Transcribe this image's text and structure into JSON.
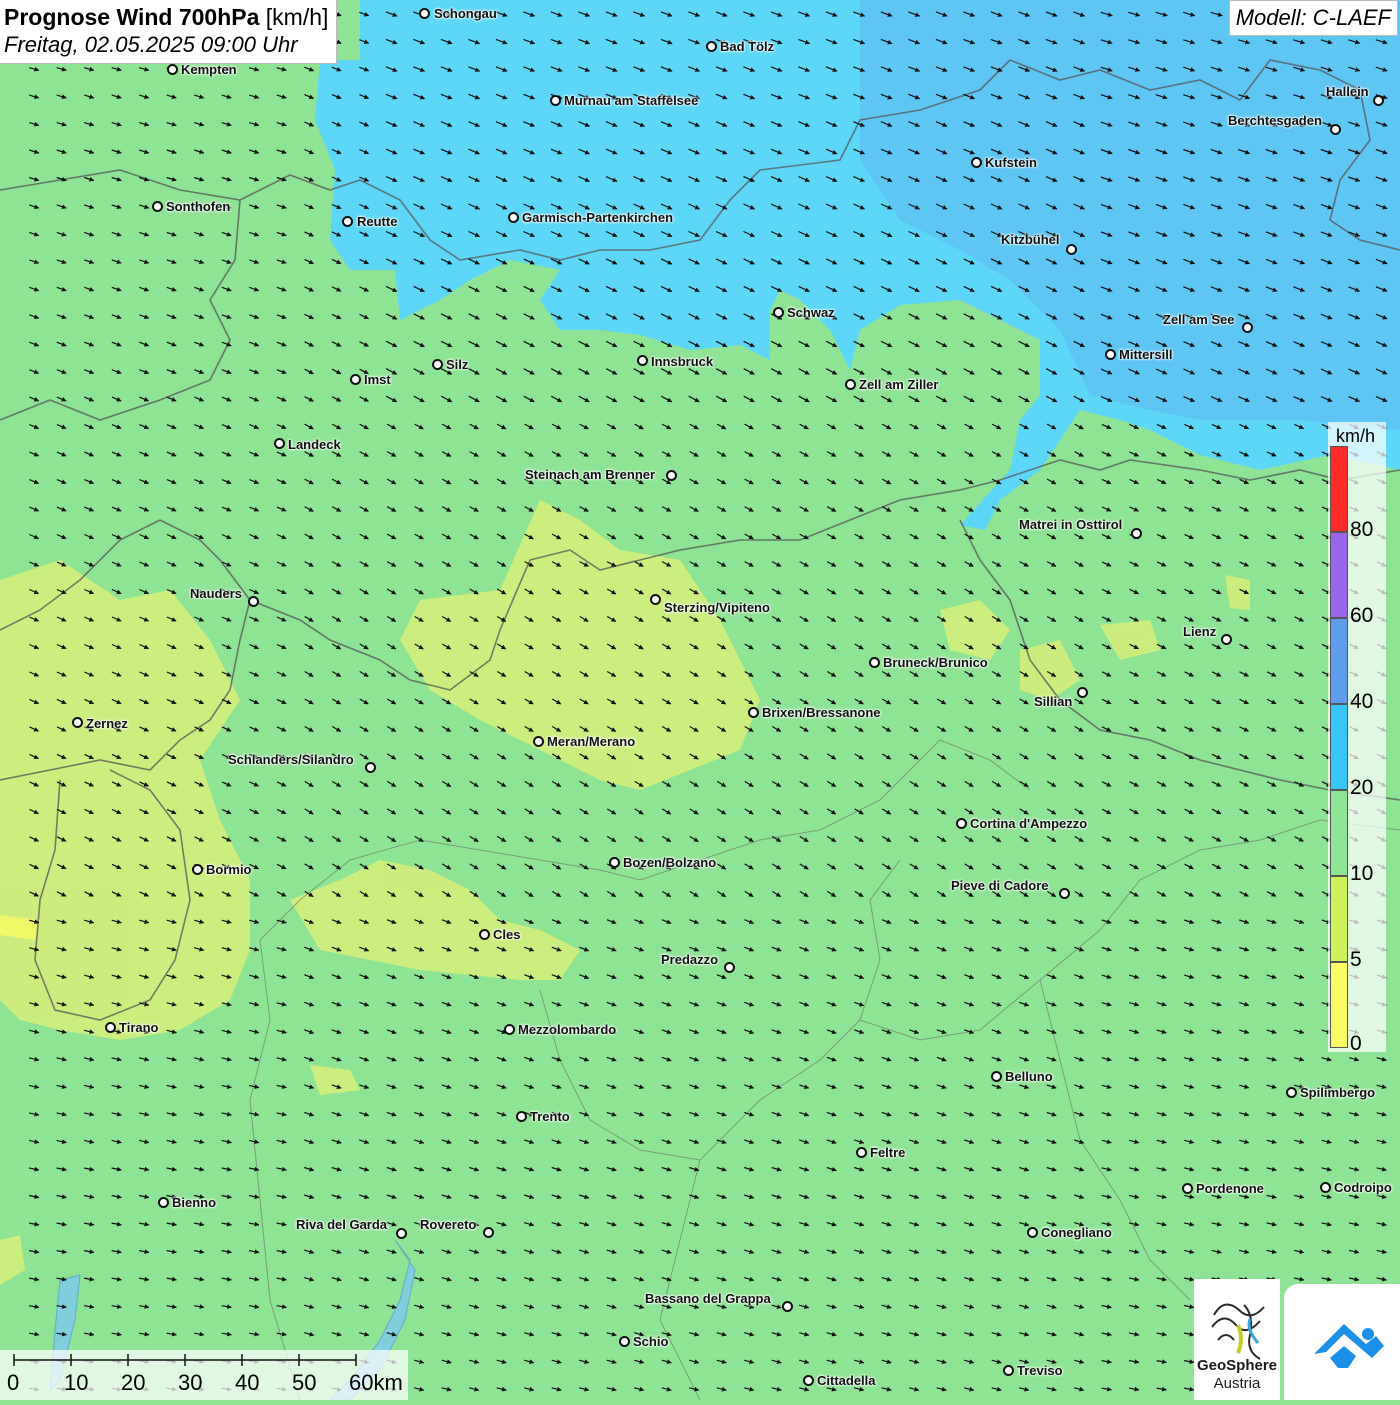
{
  "header": {
    "title_bold": "Prognose Wind 700hPa",
    "title_unit": "[km/h]",
    "subtitle": "Freitag, 02.05.2025 09:00 Uhr",
    "model": "Modell: C-LAEF"
  },
  "legend": {
    "unit": "km/h",
    "ticks": [
      "80",
      "60",
      "40",
      "20",
      "10",
      "5",
      "0"
    ],
    "colors": [
      "#fe2b2b",
      "#9a66ee",
      "#5f9ded",
      "#38c6f4",
      "#8fe394",
      "#cdf25a",
      "#fbfb66"
    ]
  },
  "scale_bar": {
    "labels": [
      "0",
      "10",
      "20",
      "30",
      "40",
      "50",
      "60km"
    ]
  },
  "logos": {
    "geosphere_line1": "GeoSphere",
    "geosphere_line2": "Austria"
  },
  "colors": {
    "calm_yellow": "#d3ee7c",
    "light_green": "#8fe394",
    "cyan": "#5dd7f8",
    "blue": "#5cb8ef"
  },
  "cities": [
    {
      "name": "Schongau",
      "dot": [
        424,
        13
      ],
      "lbl": [
        434,
        6
      ]
    },
    {
      "name": "Bad Tölz",
      "dot": [
        711,
        46
      ],
      "lbl": [
        720,
        39
      ]
    },
    {
      "name": "Kempten",
      "dot": [
        172,
        69
      ],
      "lbl": [
        181,
        62
      ]
    },
    {
      "name": "Murnau am Staffelsee",
      "dot": [
        555,
        100
      ],
      "lbl": [
        564,
        93
      ]
    },
    {
      "name": "Hallein",
      "dot": [
        1378,
        100
      ],
      "lbl": [
        1326,
        84
      ]
    },
    {
      "name": "Berchtesgaden",
      "dot": [
        1335,
        129
      ],
      "lbl": [
        1228,
        113
      ]
    },
    {
      "name": "Kufstein",
      "dot": [
        976,
        162
      ],
      "lbl": [
        985,
        155
      ]
    },
    {
      "name": "Sonthofen",
      "dot": [
        157,
        206
      ],
      "lbl": [
        166,
        199
      ]
    },
    {
      "name": "Reutte",
      "dot": [
        347,
        221
      ],
      "lbl": [
        357,
        214
      ]
    },
    {
      "name": "Garmisch-Partenkirchen",
      "dot": [
        513,
        217
      ],
      "lbl": [
        522,
        210
      ]
    },
    {
      "name": "Kitzbühel",
      "dot": [
        1071,
        249
      ],
      "lbl": [
        1001,
        232
      ]
    },
    {
      "name": "Schwaz",
      "dot": [
        778,
        312
      ],
      "lbl": [
        787,
        305
      ]
    },
    {
      "name": "Zell am See",
      "dot": [
        1247,
        327
      ],
      "lbl": [
        1163,
        312
      ]
    },
    {
      "name": "Innsbruck",
      "dot": [
        642,
        360
      ],
      "lbl": [
        651,
        354
      ]
    },
    {
      "name": "Mittersill",
      "dot": [
        1110,
        354
      ],
      "lbl": [
        1119,
        347
      ]
    },
    {
      "name": "Silz",
      "dot": [
        437,
        364
      ],
      "lbl": [
        446,
        357
      ]
    },
    {
      "name": "Imst",
      "dot": [
        355,
        379
      ],
      "lbl": [
        364,
        372
      ]
    },
    {
      "name": "Zell am Ziller",
      "dot": [
        850,
        384
      ],
      "lbl": [
        859,
        377
      ]
    },
    {
      "name": "Landeck",
      "dot": [
        279,
        443
      ],
      "lbl": [
        288,
        437
      ]
    },
    {
      "name": "Steinach am Brenner",
      "dot": [
        671,
        475
      ],
      "lbl": [
        525,
        467
      ]
    },
    {
      "name": "Matrei in Osttirol",
      "dot": [
        1136,
        533
      ],
      "lbl": [
        1019,
        517
      ]
    },
    {
      "name": "Nauders",
      "dot": [
        253,
        601
      ],
      "lbl": [
        190,
        586
      ]
    },
    {
      "name": "Sterzing/Vipiteno",
      "dot": [
        655,
        599
      ],
      "lbl": [
        664,
        600
      ]
    },
    {
      "name": "Lienz",
      "dot": [
        1226,
        639
      ],
      "lbl": [
        1183,
        624
      ]
    },
    {
      "name": "Bruneck/Brunico",
      "dot": [
        874,
        662
      ],
      "lbl": [
        883,
        655
      ]
    },
    {
      "name": "Sillian",
      "dot": [
        1082,
        692
      ],
      "lbl": [
        1034,
        694
      ]
    },
    {
      "name": "Brixen/Bressanone",
      "dot": [
        753,
        712
      ],
      "lbl": [
        762,
        705
      ]
    },
    {
      "name": "Zernez",
      "dot": [
        77,
        722
      ],
      "lbl": [
        86,
        716
      ]
    },
    {
      "name": "Meran/Merano",
      "dot": [
        538,
        741
      ],
      "lbl": [
        547,
        734
      ]
    },
    {
      "name": "Schlanders/Silandro",
      "dot": [
        370,
        767
      ],
      "lbl": [
        228,
        752
      ]
    },
    {
      "name": "Cortina d'Ampezzo",
      "dot": [
        961,
        823
      ],
      "lbl": [
        970,
        816
      ]
    },
    {
      "name": "Bozen/Bolzano",
      "dot": [
        614,
        862
      ],
      "lbl": [
        623,
        855
      ]
    },
    {
      "name": "Bormio",
      "dot": [
        197,
        869
      ],
      "lbl": [
        206,
        862
      ]
    },
    {
      "name": "Pieve di Cadore",
      "dot": [
        1064,
        893
      ],
      "lbl": [
        951,
        878
      ]
    },
    {
      "name": "Cles",
      "dot": [
        484,
        934
      ],
      "lbl": [
        493,
        927
      ]
    },
    {
      "name": "Predazzo",
      "dot": [
        729,
        967
      ],
      "lbl": [
        661,
        952
      ]
    },
    {
      "name": "Tirano",
      "dot": [
        110,
        1027
      ],
      "lbl": [
        119,
        1020
      ]
    },
    {
      "name": "Mezzolombardo",
      "dot": [
        509,
        1029
      ],
      "lbl": [
        518,
        1022
      ]
    },
    {
      "name": "Belluno",
      "dot": [
        996,
        1076
      ],
      "lbl": [
        1005,
        1069
      ]
    },
    {
      "name": "Spilimbergo",
      "dot": [
        1291,
        1092
      ],
      "lbl": [
        1300,
        1085
      ]
    },
    {
      "name": "Trento",
      "dot": [
        521,
        1116
      ],
      "lbl": [
        530,
        1109
      ]
    },
    {
      "name": "Feltre",
      "dot": [
        861,
        1152
      ],
      "lbl": [
        870,
        1145
      ]
    },
    {
      "name": "Pordenone",
      "dot": [
        1187,
        1188
      ],
      "lbl": [
        1196,
        1181
      ]
    },
    {
      "name": "Codroipo",
      "dot": [
        1325,
        1187
      ],
      "lbl": [
        1334,
        1180
      ]
    },
    {
      "name": "Bienno",
      "dot": [
        163,
        1202
      ],
      "lbl": [
        172,
        1195
      ]
    },
    {
      "name": "Riva del Garda",
      "dot": [
        401,
        1233
      ],
      "lbl": [
        296,
        1217
      ]
    },
    {
      "name": "Rovereto",
      "dot": [
        488,
        1232
      ],
      "lbl": [
        420,
        1217
      ]
    },
    {
      "name": "Conegliano",
      "dot": [
        1032,
        1232
      ],
      "lbl": [
        1041,
        1225
      ]
    },
    {
      "name": "Bassano del Grappa",
      "dot": [
        787,
        1306
      ],
      "lbl": [
        645,
        1291
      ]
    },
    {
      "name": "Schio",
      "dot": [
        624,
        1341
      ],
      "lbl": [
        633,
        1334
      ]
    },
    {
      "name": "Treviso",
      "dot": [
        1008,
        1370
      ],
      "lbl": [
        1017,
        1363
      ]
    },
    {
      "name": "Cittadella",
      "dot": [
        808,
        1380
      ],
      "lbl": [
        817,
        1373
      ]
    }
  ]
}
